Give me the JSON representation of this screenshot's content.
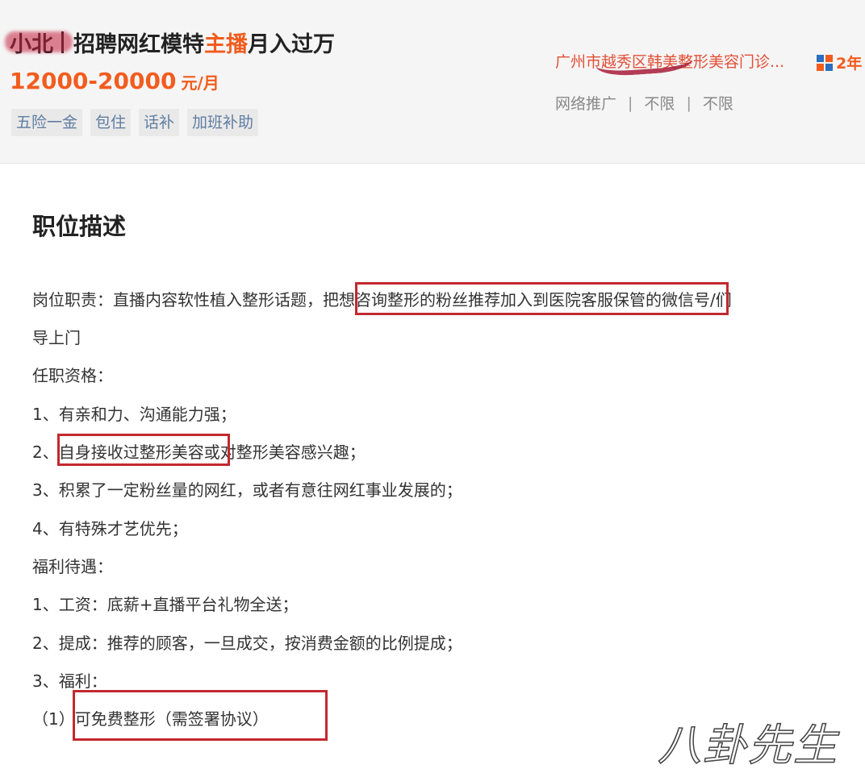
{
  "job": {
    "company_short": "小北",
    "title_prefix": "招聘网红模特",
    "title_highlight": "主播",
    "title_suffix": "月入过万",
    "salary": "12000-20000",
    "salary_unit": "元/月",
    "welfare_tags": [
      "五险一金",
      "包住",
      "话补",
      "加班补助"
    ]
  },
  "company": {
    "name": "广州市越秀区韩美整形美容门诊...",
    "years": "2年",
    "meta": [
      "网络推广",
      "不限",
      "不限"
    ]
  },
  "description": {
    "title": "职位描述",
    "lines": [
      "岗位职责：直播内容软性植入整形话题，把想咨询整形的粉丝推荐加入到医院客服保管的微信号/们",
      "导上门",
      "任职资格：",
      "1、有亲和力、沟通能力强；",
      "2、自身接收过整形美容或对整形美容感兴趣；",
      "3、积累了一定粉丝量的网红，或者有意往网红事业发展的；",
      "4、有特殊才艺优先；",
      "福利待遇：",
      "1、工资：底薪+直播平台礼物全送；",
      "2、提成：推荐的顾客，一旦成交，按消费金额的比例提成；",
      "3、福利：",
      "（1）可免费整形（需签署协议）"
    ]
  },
  "watermark": "八卦先生",
  "colors": {
    "accent": "#f25c1e",
    "tag_text": "#5f7ea3",
    "annotation_box": "#c3282f"
  }
}
